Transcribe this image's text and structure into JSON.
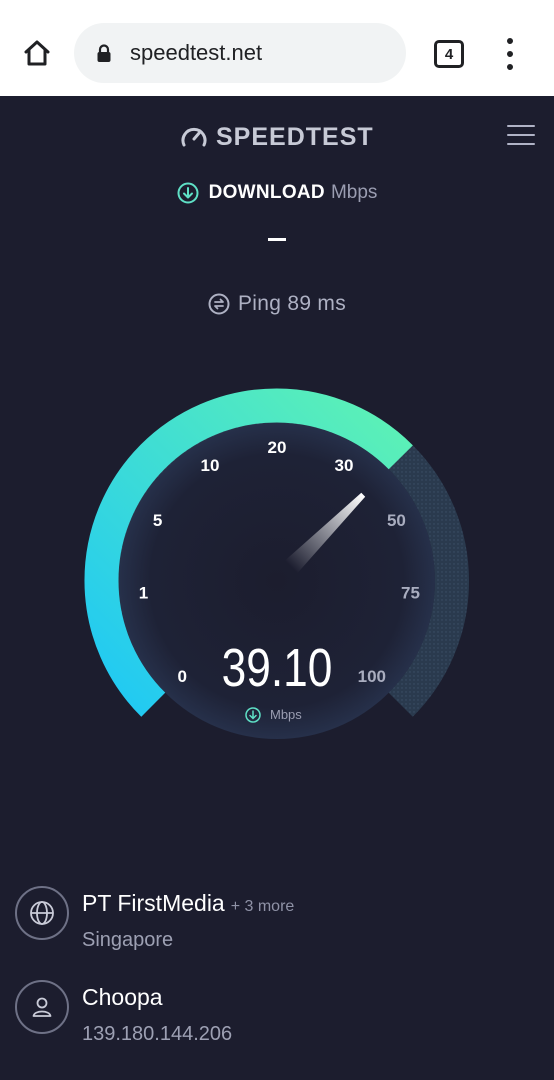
{
  "browser": {
    "url": "speedtest.net",
    "tab_count": "4"
  },
  "app": {
    "brand": "SPEEDTEST",
    "download": {
      "title": "DOWNLOAD",
      "unit": "Mbps"
    },
    "ping": {
      "label": "Ping 89 ms"
    },
    "gauge": {
      "value": "39.10",
      "value_numeric": 39.1,
      "unit": "Mbps",
      "ticks": [
        "0",
        "1",
        "5",
        "10",
        "20",
        "30",
        "50",
        "75",
        "100"
      ],
      "colors": {
        "progress_start": "#1fc8f5",
        "progress_end": "#5ef2b4",
        "track": "#2a3a4e",
        "background": "#1c1d2e"
      }
    },
    "isp": {
      "name": "PT FirstMedia",
      "more": "+ 3 more",
      "location": "Singapore"
    },
    "host": {
      "name": "Choopa",
      "ip": "139.180.144.206"
    }
  }
}
